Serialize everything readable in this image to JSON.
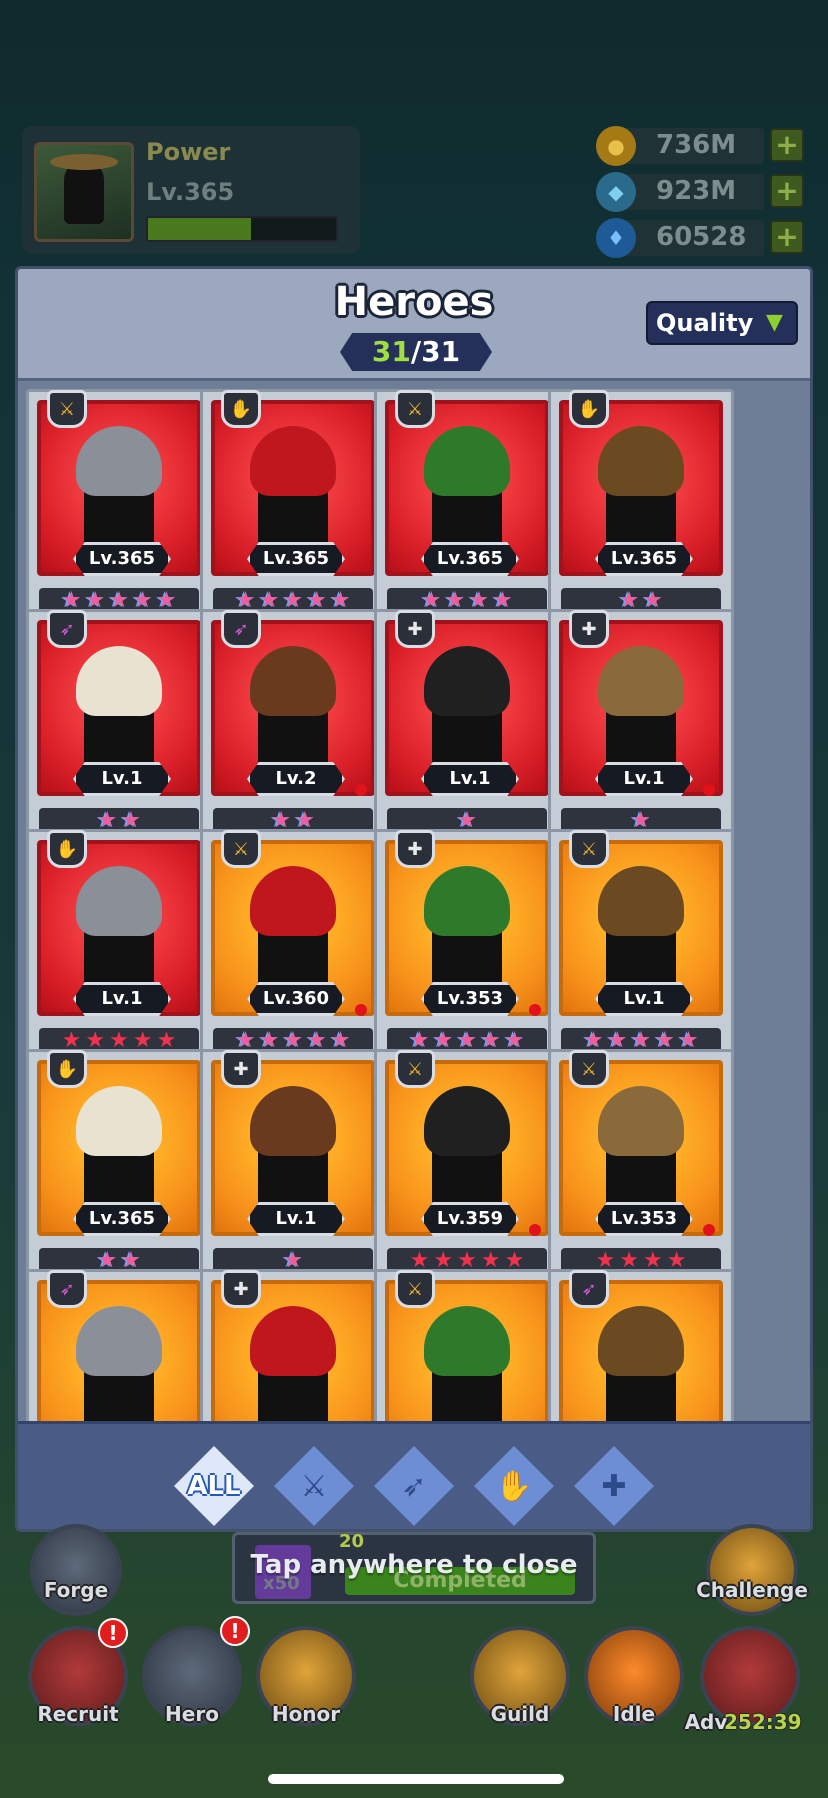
{
  "hud": {
    "power_label": "Power",
    "power_level": "Lv.365",
    "power_progress": 0.55,
    "currencies": [
      {
        "icon": "gold-coin-icon",
        "value": "736M",
        "color": "#d8a21e"
      },
      {
        "icon": "potion-icon",
        "value": "923M",
        "color": "#3aa0d0"
      },
      {
        "icon": "diamond-icon",
        "value": "60528",
        "color": "#2e86d8"
      }
    ]
  },
  "panel": {
    "title": "Heroes",
    "count_current": "31",
    "count_total": "/31",
    "quality_label": "Quality"
  },
  "heroes": [
    {
      "level": "Lv.365",
      "quality": "red",
      "class": "warrior",
      "stars": 5,
      "star_color": "blue",
      "dot": false
    },
    {
      "level": "Lv.365",
      "quality": "red",
      "class": "mage",
      "stars": 5,
      "star_color": "blue",
      "dot": false
    },
    {
      "level": "Lv.365",
      "quality": "red",
      "class": "warrior",
      "stars": 4,
      "star_color": "blue",
      "dot": false
    },
    {
      "level": "Lv.365",
      "quality": "red",
      "class": "mage",
      "stars": 2,
      "star_color": "blue",
      "dot": false
    },
    {
      "level": "Lv.1",
      "quality": "red",
      "class": "ranger",
      "stars": 2,
      "star_color": "blue",
      "dot": false
    },
    {
      "level": "Lv.2",
      "quality": "red",
      "class": "ranger",
      "stars": 2,
      "star_color": "blue",
      "dot": true
    },
    {
      "level": "Lv.1",
      "quality": "red",
      "class": "support",
      "stars": 1,
      "star_color": "blue",
      "dot": false
    },
    {
      "level": "Lv.1",
      "quality": "red",
      "class": "support",
      "stars": 1,
      "star_color": "blue",
      "dot": true
    },
    {
      "level": "Lv.1",
      "quality": "red",
      "class": "mage",
      "stars": 5,
      "star_color": "red",
      "dot": false
    },
    {
      "level": "Lv.360",
      "quality": "orange",
      "class": "warrior",
      "stars": 5,
      "star_color": "blue",
      "dot": true
    },
    {
      "level": "Lv.353",
      "quality": "orange",
      "class": "support",
      "stars": 5,
      "star_color": "blue",
      "dot": true
    },
    {
      "level": "Lv.1",
      "quality": "orange",
      "class": "warrior",
      "stars": 5,
      "star_color": "blue",
      "dot": false
    },
    {
      "level": "Lv.365",
      "quality": "orange",
      "class": "mage",
      "stars": 2,
      "star_color": "blue",
      "dot": false
    },
    {
      "level": "Lv.1",
      "quality": "orange",
      "class": "support",
      "stars": 1,
      "star_color": "blue",
      "dot": false
    },
    {
      "level": "Lv.359",
      "quality": "orange",
      "class": "warrior",
      "stars": 5,
      "star_color": "red",
      "dot": true
    },
    {
      "level": "Lv.353",
      "quality": "orange",
      "class": "warrior",
      "stars": 4,
      "star_color": "red",
      "dot": true
    },
    {
      "level": "",
      "quality": "orange",
      "class": "ranger",
      "stars": 0,
      "star_color": "blue",
      "dot": false
    },
    {
      "level": "",
      "quality": "orange",
      "class": "support",
      "stars": 0,
      "star_color": "blue",
      "dot": false
    },
    {
      "level": "",
      "quality": "orange",
      "class": "warrior",
      "stars": 0,
      "star_color": "blue",
      "dot": false
    },
    {
      "level": "",
      "quality": "orange",
      "class": "ranger",
      "stars": 0,
      "star_color": "blue",
      "dot": false
    }
  ],
  "filters": [
    {
      "name": "filter-all",
      "label": "ALL",
      "icon": "all-icon",
      "active": true
    },
    {
      "name": "filter-warrior",
      "label": "",
      "icon": "sword-icon",
      "active": false
    },
    {
      "name": "filter-ranger",
      "label": "",
      "icon": "crossed-arrows-icon",
      "active": false
    },
    {
      "name": "filter-mage",
      "label": "",
      "icon": "crystal-hand-icon",
      "active": false
    },
    {
      "name": "filter-support",
      "label": "",
      "icon": "medic-icon",
      "active": false
    }
  ],
  "background_hud": {
    "tap_to_close": "Tap anywhere  to close",
    "quest_count": "20",
    "quest_multiplier": "x50",
    "quest_status": "Completed",
    "buttons": [
      {
        "label": "Forge"
      },
      {
        "label": "Challenge"
      },
      {
        "label": "Recruit",
        "alert": "!"
      },
      {
        "label": "Hero",
        "alert": "!"
      },
      {
        "label": "Honor"
      },
      {
        "label": "Guild"
      },
      {
        "label": "Idle"
      },
      {
        "label": "Adv"
      }
    ],
    "adv_timer": "252:39"
  }
}
